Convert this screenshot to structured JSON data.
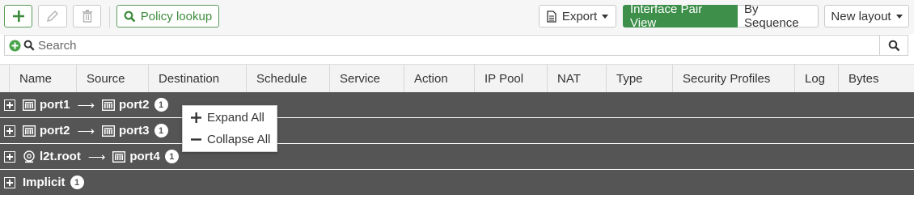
{
  "toolbar": {
    "policy_lookup_label": "Policy lookup",
    "export_label": "Export",
    "interface_pair_view_label": "Interface Pair View",
    "by_sequence_label": "By Sequence",
    "new_layout_label": "New layout"
  },
  "search": {
    "placeholder": "Search"
  },
  "table": {
    "columns": [
      "Name",
      "Source",
      "Destination",
      "Schedule",
      "Service",
      "Action",
      "IP Pool",
      "NAT",
      "Type",
      "Security Profiles",
      "Log",
      "Bytes"
    ]
  },
  "groups": [
    {
      "from": "port1",
      "to": "port2",
      "count": "1"
    },
    {
      "from": "port2",
      "to": "port3",
      "count": "1"
    },
    {
      "from": "l2t.root",
      "to": "port4",
      "count": "1"
    },
    {
      "label": "Implicit",
      "count": "1"
    }
  ],
  "context_menu": {
    "expand_all": "Expand All",
    "collapse_all": "Collapse All"
  },
  "colors": {
    "accent_green": "#3d8f4a",
    "group_row_bg": "#555555"
  }
}
